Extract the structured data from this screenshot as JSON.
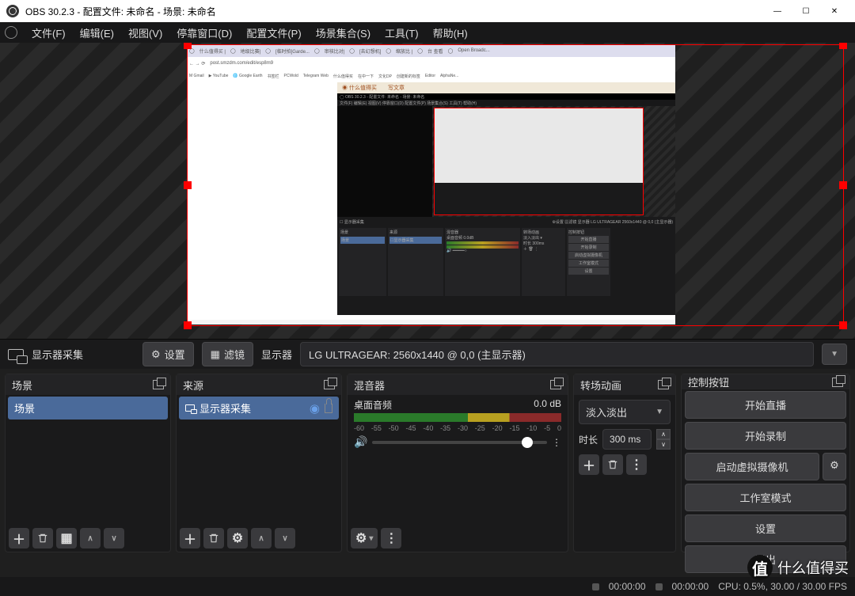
{
  "titlebar": {
    "text": "OBS 30.2.3 - 配置文件: 未命名 - 场景: 未命名"
  },
  "menu": [
    "文件(F)",
    "编辑(E)",
    "视图(V)",
    "停靠窗口(D)",
    "配置文件(P)",
    "场景集合(S)",
    "工具(T)",
    "帮助(H)"
  ],
  "sourcebar": {
    "source_label": "显示器采集",
    "settings_btn": "设置",
    "filter_btn": "滤镜",
    "display_label": "显示器",
    "display_value": "LG ULTRAGEAR: 2560x1440 @ 0,0 (主显示器)"
  },
  "docks": {
    "scenes": {
      "title": "场景",
      "item": "场景"
    },
    "sources": {
      "title": "来源",
      "item": "显示器采集"
    },
    "mixer": {
      "title": "混音器",
      "desktop_audio": "桌面音频",
      "level": "0.0 dB",
      "ticks": [
        "-60",
        "-55",
        "-50",
        "-45",
        "-40",
        "-35",
        "-30",
        "-25",
        "-20",
        "-15",
        "-10",
        "-5",
        "0"
      ]
    },
    "transitions": {
      "title": "转场动画",
      "type": "淡入淡出",
      "duration_label": "时长",
      "duration_value": "300 ms"
    },
    "controls": {
      "title": "控制按钮",
      "buttons": [
        "开始直播",
        "开始录制",
        "启动虚拟摄像机",
        "工作室模式",
        "设置",
        "退出"
      ]
    }
  },
  "status": {
    "time1": "00:00:00",
    "time2": "00:00:00",
    "cpu": "CPU: 0.5%, 30.00 / 30.00 FPS"
  },
  "preview_thumb": {
    "url": "post.smzdm.com/edit/esp8m9",
    "bookmarks": [
      "Gmail",
      "YouTube",
      "Google Earth",
      "PCWold",
      "Telegram Web",
      "什么值得买"
    ]
  },
  "watermark": "什么值得买"
}
